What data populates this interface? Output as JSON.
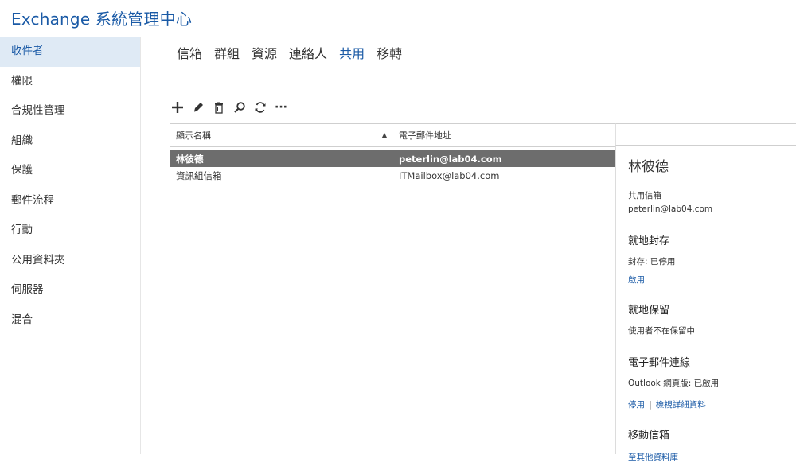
{
  "app": {
    "title": "Exchange 系統管理中心"
  },
  "sidebar": {
    "items": [
      {
        "label": "收件者",
        "active": true
      },
      {
        "label": "權限"
      },
      {
        "label": "合規性管理"
      },
      {
        "label": "組織"
      },
      {
        "label": "保護"
      },
      {
        "label": "郵件流程"
      },
      {
        "label": "行動"
      },
      {
        "label": "公用資料夾"
      },
      {
        "label": "伺服器"
      },
      {
        "label": "混合"
      }
    ]
  },
  "tabs": [
    {
      "label": "信箱"
    },
    {
      "label": "群組"
    },
    {
      "label": "資源"
    },
    {
      "label": "連絡人"
    },
    {
      "label": "共用",
      "active": true
    },
    {
      "label": "移轉"
    }
  ],
  "toolbar": {
    "add_icon": "plus-icon",
    "edit_icon": "pencil-icon",
    "delete_icon": "trash-icon",
    "search_icon": "search-icon",
    "refresh_icon": "refresh-icon",
    "more_icon": "more-icon",
    "more_label": "···"
  },
  "list": {
    "columns": [
      "顯示名稱",
      "電子郵件地址"
    ],
    "sort_indicator": "▲",
    "rows": [
      {
        "name": "林彼德",
        "email": "peterlin@lab04.com",
        "selected": true
      },
      {
        "name": "資訊組信箱",
        "email": "ITMailbox@lab04.com"
      }
    ]
  },
  "detail": {
    "name": "林彼德",
    "type": "共用信箱",
    "email": "peterlin@lab04.com",
    "archive_title": "就地封存",
    "archive_status": "封存: 已停用",
    "archive_enable_link": "啟用",
    "hold_title": "就地保留",
    "hold_status": "使用者不在保留中",
    "connectivity_title": "電子郵件連線",
    "owa_status": "Outlook 網頁版: 已啟用",
    "disable_link": "停用",
    "separator": "|",
    "view_details_link": "檢視詳細資料",
    "move_title": "移動信箱",
    "move_link": "至其他資料庫"
  },
  "colors": {
    "accent": "#1a5aa6",
    "selected_row": "#6d6d6d",
    "active_side": "#dfeaf5"
  }
}
